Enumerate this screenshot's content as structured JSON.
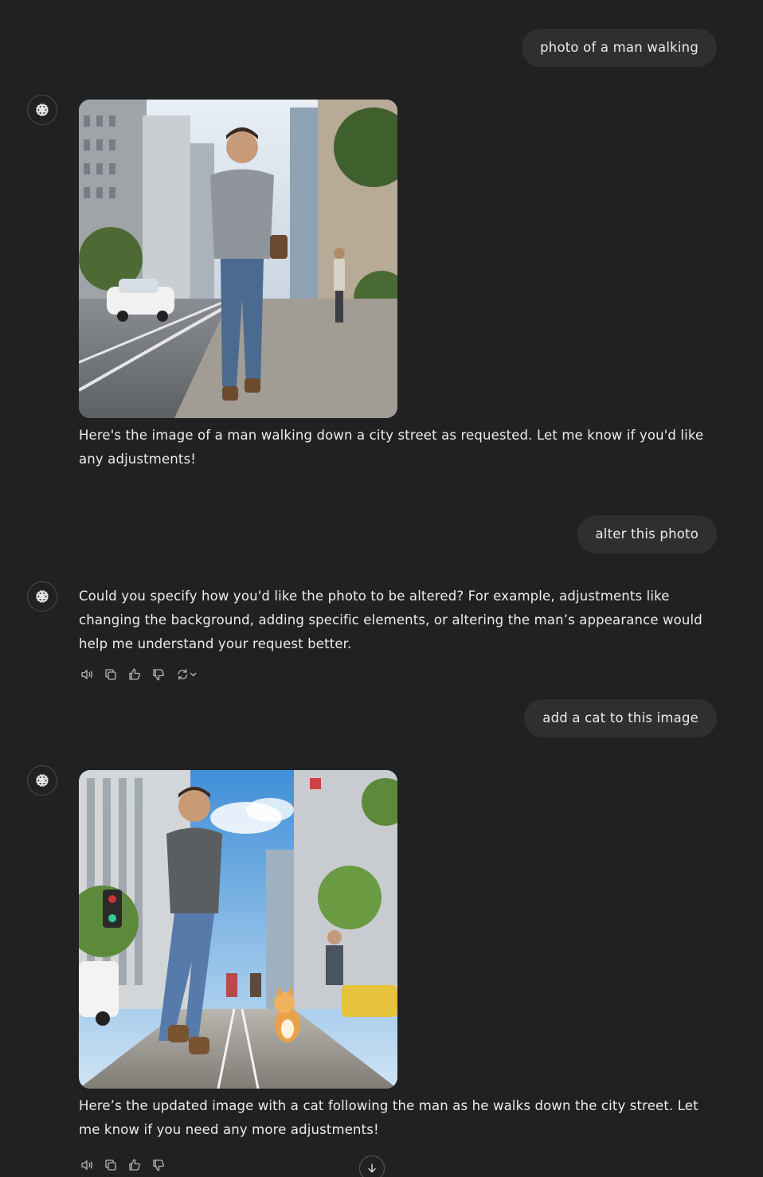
{
  "colors": {
    "background": "#212121",
    "user_bubble": "#2f2f2f",
    "text": "#ececec",
    "icon": "#b4b4b4"
  },
  "messages": [
    {
      "role": "user",
      "text": "photo of a man walking"
    },
    {
      "role": "assistant",
      "image": "generated-image-man-walking-city-street",
      "text": "Here's the image of a man walking down a city street as requested. Let me know if you'd like any adjustments!"
    },
    {
      "role": "user",
      "text": "alter this photo"
    },
    {
      "role": "assistant",
      "text": "Could you specify how you'd like the photo to be altered? For example, adjustments like changing the background, adding specific elements, or altering the man’s appearance would help me understand your request better.",
      "actions": [
        "speaker-icon",
        "copy-icon",
        "thumbs-up-icon",
        "thumbs-down-icon",
        "regenerate-icon"
      ]
    },
    {
      "role": "user",
      "text": "add a cat to this image"
    },
    {
      "role": "assistant",
      "image": "generated-image-man-walking-with-cat",
      "text": "Here’s the updated image with a cat following the man as he walks down the city street. Let me know if you need any more adjustments!",
      "actions": [
        "speaker-icon",
        "copy-icon",
        "thumbs-up-icon",
        "thumbs-down-icon"
      ]
    }
  ],
  "scroll_button": "arrow-down-icon"
}
